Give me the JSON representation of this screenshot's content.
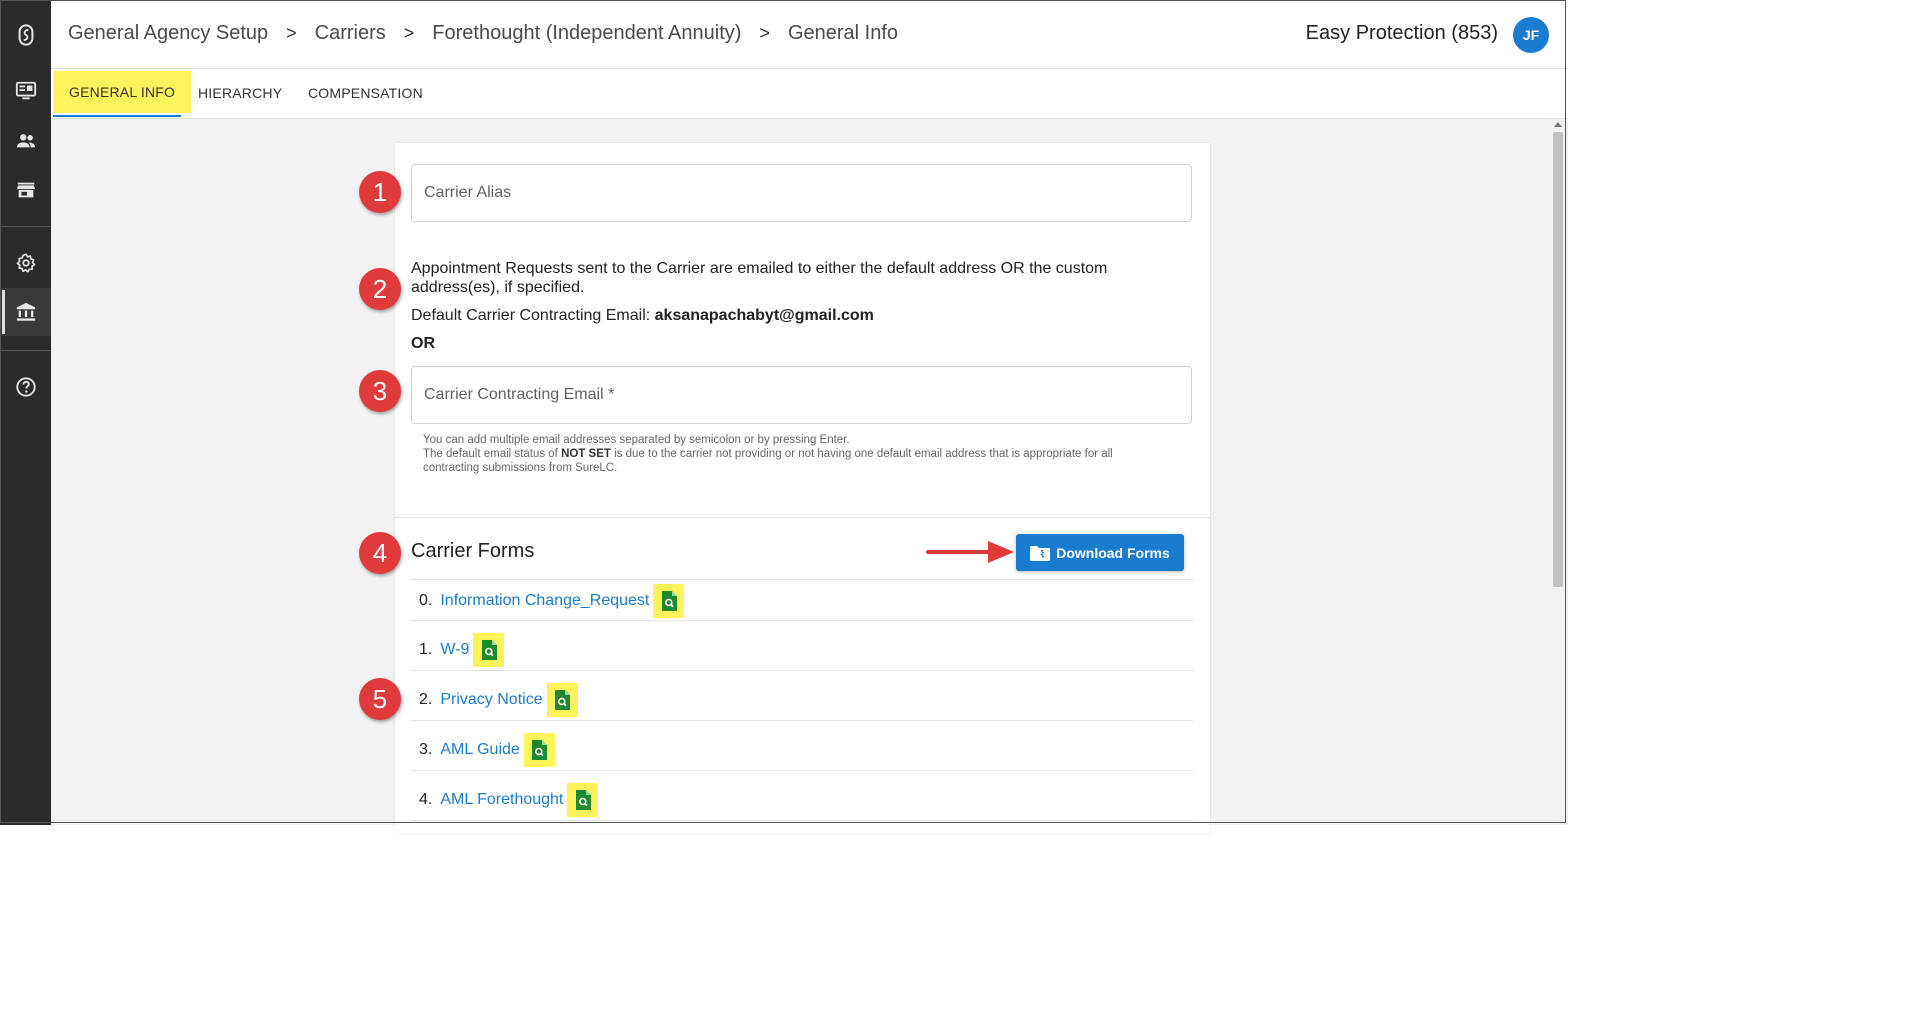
{
  "sidebar": {
    "items": [
      {
        "icon": "logo-icon"
      },
      {
        "icon": "dashboard-monitor-icon"
      },
      {
        "icon": "people-icon"
      },
      {
        "icon": "store-icon"
      },
      {
        "icon": "gear-icon"
      },
      {
        "icon": "bank-icon",
        "active": true
      },
      {
        "icon": "help-icon"
      }
    ]
  },
  "header": {
    "breadcrumbs": [
      "General Agency Setup",
      "Carriers",
      "Forethought (Independent Annuity)",
      "General Info"
    ],
    "separator": ">",
    "agency": "Easy Protection (853)",
    "avatar_initials": "JF"
  },
  "tabs": [
    {
      "label": "GENERAL INFO",
      "active": true
    },
    {
      "label": "HIERARCHY",
      "active": false
    },
    {
      "label": "COMPENSATION",
      "active": false
    }
  ],
  "form": {
    "carrier_alias_placeholder": "Carrier Alias",
    "appointment_text_line1": "Appointment Requests sent to the Carrier are emailed to either the default address OR the custom",
    "appointment_text_line2": "address(es), if specified.",
    "default_email_label": "Default Carrier Contracting Email: ",
    "default_email_value": "aksanapachabyt@gmail.com",
    "or_label": "OR",
    "contracting_email_placeholder": "Carrier Contracting Email *",
    "hint_line1": "You can add multiple email addresses separated by semicolon or by pressing Enter.",
    "hint_line2_pre": "The default email status of ",
    "hint_line2_bold": "NOT SET",
    "hint_line2_post": " is due to the carrier not providing or not having one default email address that is appropriate for all",
    "hint_line3": "contracting submissions from SureLC."
  },
  "carrier_forms": {
    "title": "Carrier Forms",
    "download_label": "Download Forms",
    "items": [
      {
        "num": "0.",
        "name": "Information Change_Request"
      },
      {
        "num": "1.",
        "name": "W-9"
      },
      {
        "num": "2.",
        "name": "Privacy Notice"
      },
      {
        "num": "3.",
        "name": "AML Guide"
      },
      {
        "num": "4.",
        "name": "AML Forethought"
      }
    ]
  },
  "annotations": [
    "1",
    "2",
    "3",
    "4",
    "5"
  ],
  "colors": {
    "accent": "#1a7ccf",
    "highlight": "#fff35c",
    "marker": "#e03b3b",
    "sidebar": "#2b2b2b",
    "pdf_icon": "#1e8a2e"
  }
}
